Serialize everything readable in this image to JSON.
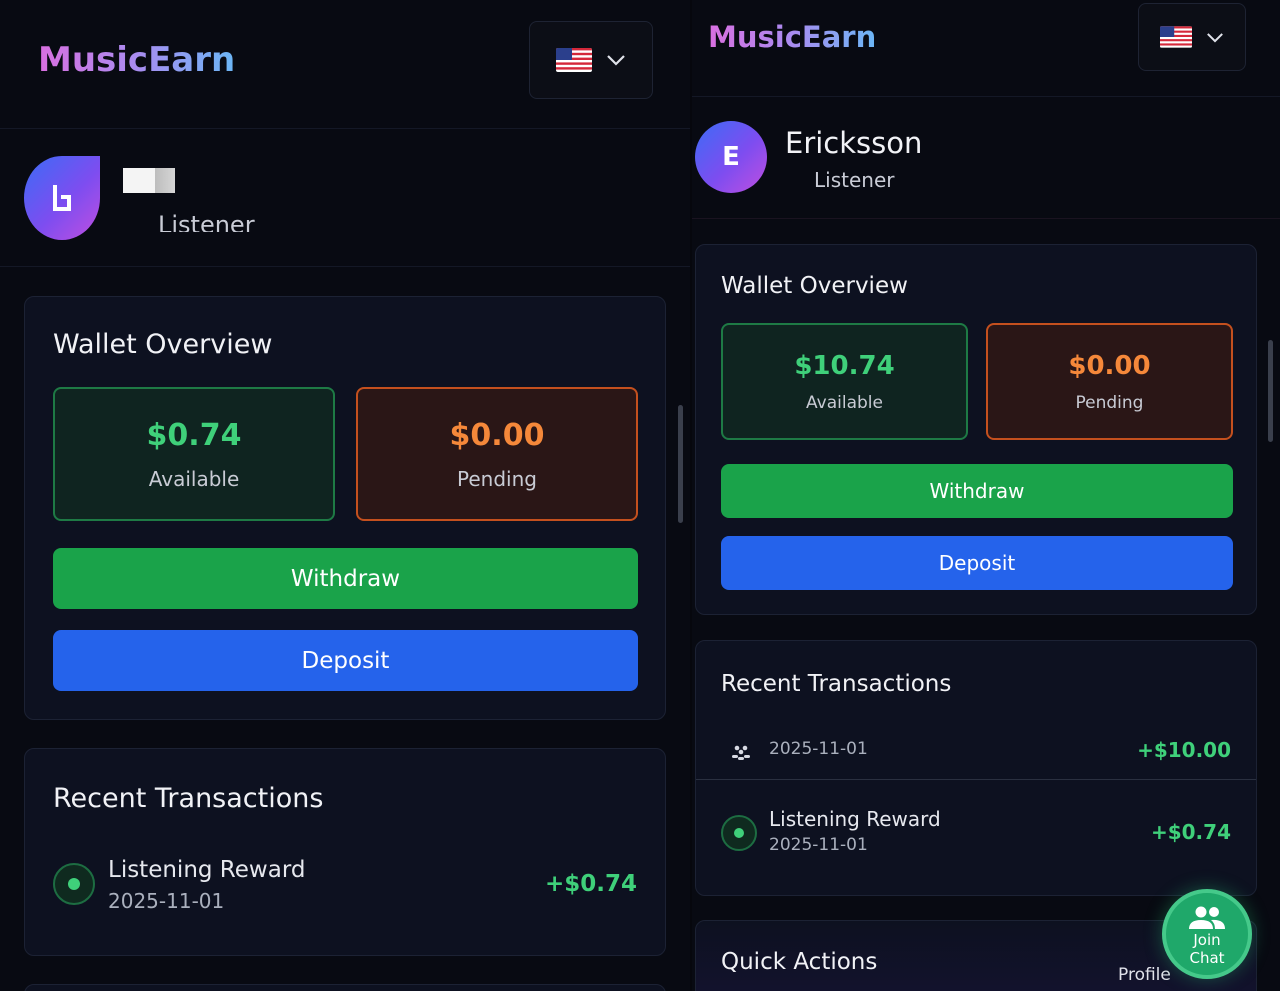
{
  "app": {
    "logo": "MusicEarn",
    "lang_icon": "us-flag-icon"
  },
  "left": {
    "user": {
      "role": "Listener"
    },
    "wallet": {
      "title": "Wallet Overview",
      "available_amount": "$0.74",
      "available_label": "Available",
      "pending_amount": "$0.00",
      "pending_label": "Pending",
      "withdraw_label": "Withdraw",
      "deposit_label": "Deposit"
    },
    "transactions": {
      "title": "Recent Transactions",
      "items": [
        {
          "title": "Listening Reward",
          "date": "2025-11-01",
          "amount": "+$0.74"
        }
      ]
    }
  },
  "right": {
    "user": {
      "initial": "E",
      "name": "Ericksson",
      "role": "Listener"
    },
    "wallet": {
      "title": "Wallet Overview",
      "available_amount": "$10.74",
      "available_label": "Available",
      "pending_amount": "$0.00",
      "pending_label": "Pending",
      "withdraw_label": "Withdraw",
      "deposit_label": "Deposit"
    },
    "transactions": {
      "title": "Recent Transactions",
      "items": [
        {
          "title": "",
          "date": "2025-11-01",
          "amount": "+$10.00"
        },
        {
          "title": "Listening Reward",
          "date": "2025-11-01",
          "amount": "+$0.74"
        }
      ]
    },
    "quick_actions": {
      "title": "Quick Actions",
      "profile_label": "Profile"
    },
    "chat_fab": {
      "line1": "Join",
      "line2": "Chat"
    }
  },
  "colors": {
    "accent_green": "#1aa34a",
    "accent_blue": "#2563eb",
    "available_text": "#3fd07a",
    "pending_text": "#f5883a",
    "background": "#080a12"
  }
}
